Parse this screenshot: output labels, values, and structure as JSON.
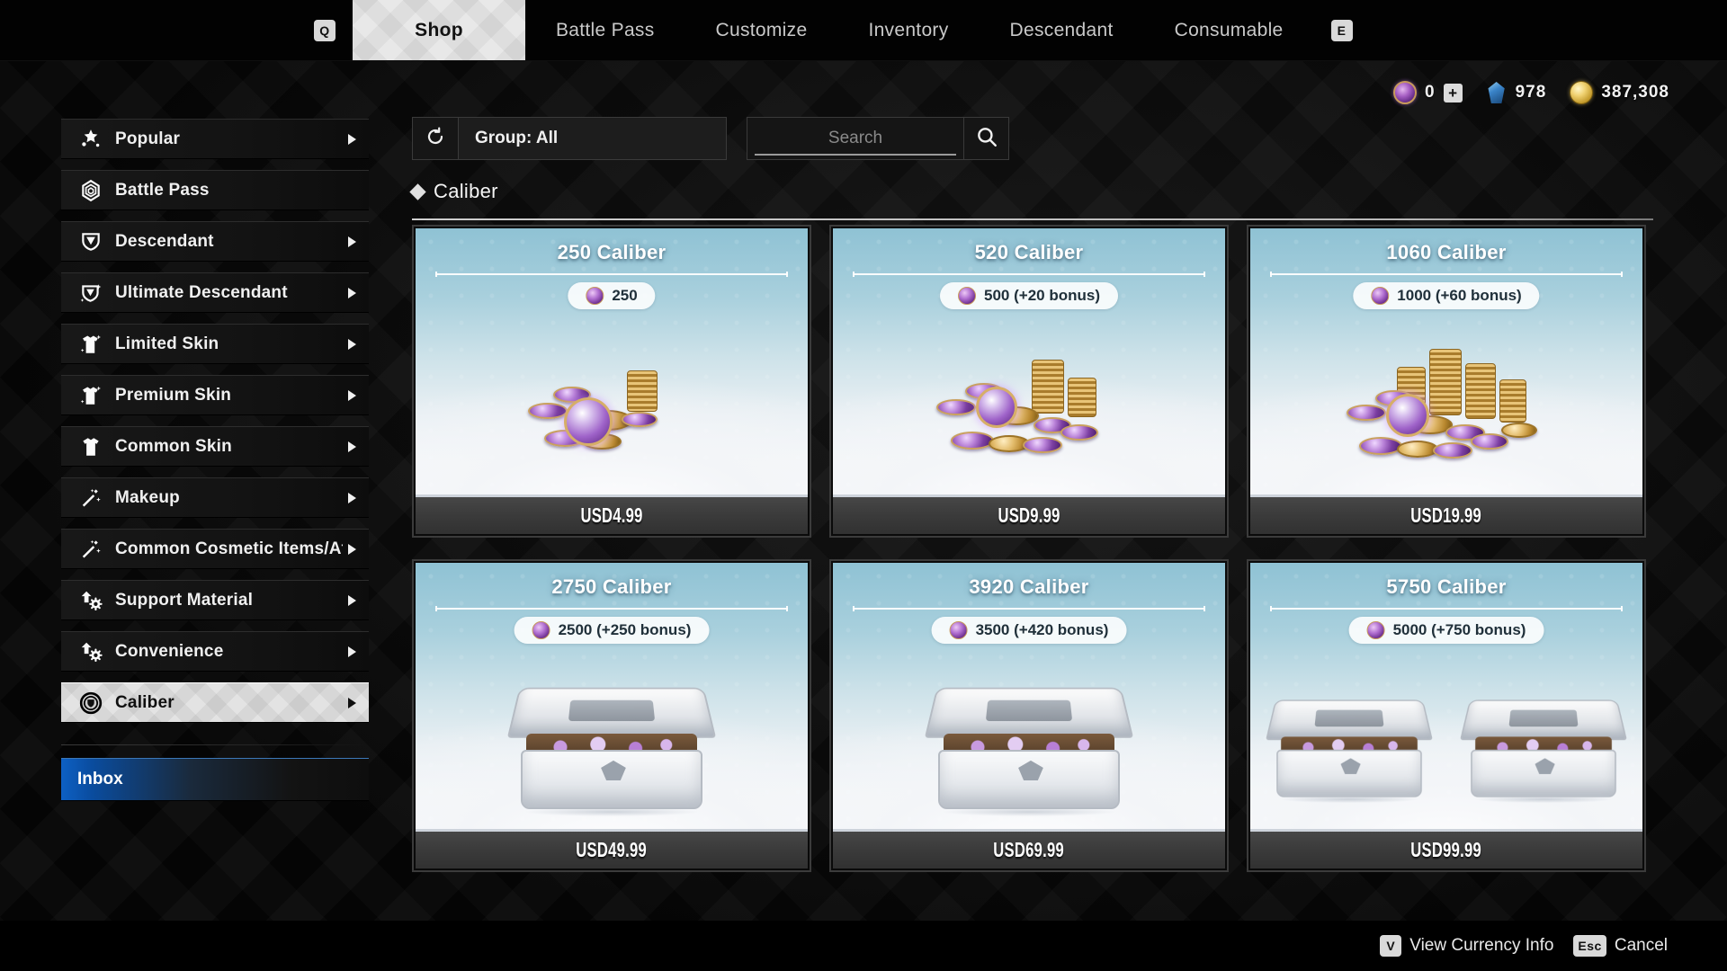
{
  "topnav": {
    "left_key": "Q",
    "right_key": "E",
    "tabs": [
      {
        "label": "Shop",
        "active": true
      },
      {
        "label": "Battle Pass",
        "active": false
      },
      {
        "label": "Customize",
        "active": false
      },
      {
        "label": "Inventory",
        "active": false
      },
      {
        "label": "Descendant",
        "active": false
      },
      {
        "label": "Consumable",
        "active": false
      }
    ]
  },
  "currency": [
    {
      "icon": "caliber-icon",
      "value": "0",
      "has_plus": true,
      "plus_label": "+"
    },
    {
      "icon": "crystal-icon",
      "value": "978",
      "has_plus": false
    },
    {
      "icon": "gold-icon",
      "value": "387,308",
      "has_plus": false
    }
  ],
  "sidebar": {
    "items": [
      {
        "label": "Popular",
        "icon": "stars-icon",
        "chevron": true,
        "selected": false
      },
      {
        "label": "Battle Pass",
        "icon": "hex-spiral-icon",
        "chevron": false,
        "selected": false
      },
      {
        "label": "Descendant",
        "icon": "chevron-crest-icon",
        "chevron": true,
        "selected": false
      },
      {
        "label": "Ultimate Descendant",
        "icon": "chevron-crest-sparkle-icon",
        "chevron": true,
        "selected": false
      },
      {
        "label": "Limited Skin",
        "icon": "shirt-sparkle-icon",
        "chevron": true,
        "selected": false
      },
      {
        "label": "Premium Skin",
        "icon": "shirt-sparkle-icon",
        "chevron": true,
        "selected": false
      },
      {
        "label": "Common Skin",
        "icon": "shirt-icon",
        "chevron": true,
        "selected": false
      },
      {
        "label": "Makeup",
        "icon": "magic-wand-icon",
        "chevron": true,
        "selected": false
      },
      {
        "label": "Common Cosmetic Items/Atta",
        "icon": "magic-wand-icon",
        "chevron": true,
        "selected": false
      },
      {
        "label": "Support Material",
        "icon": "upgrade-gear-icon",
        "chevron": true,
        "selected": false
      },
      {
        "label": "Convenience",
        "icon": "upgrade-gear-icon",
        "chevron": true,
        "selected": false
      },
      {
        "label": "Caliber",
        "icon": "caliber-crest-icon",
        "chevron": true,
        "selected": true
      }
    ],
    "inbox": {
      "label": "Inbox",
      "icon": "inbox-icon"
    }
  },
  "toolbar": {
    "refresh_icon": "refresh-icon",
    "group_label": "Group: All",
    "search_value": "",
    "search_placeholder": "Search",
    "search_icon": "search-icon"
  },
  "section": {
    "bullet_icon": "diamond-bullet-icon",
    "title": "Caliber"
  },
  "cards": [
    {
      "title": "250 Caliber",
      "amount": "250",
      "price": "USD4.99",
      "art": "coins-small"
    },
    {
      "title": "520 Caliber",
      "amount": "500 (+20 bonus)",
      "price": "USD9.99",
      "art": "coins-medium"
    },
    {
      "title": "1060 Caliber",
      "amount": "1000 (+60 bonus)",
      "price": "USD19.99",
      "art": "coins-large"
    },
    {
      "title": "2750 Caliber",
      "amount": "2500 (+250 bonus)",
      "price": "USD49.99",
      "art": "chest-one"
    },
    {
      "title": "3920 Caliber",
      "amount": "3500 (+420 bonus)",
      "price": "USD69.99",
      "art": "chest-one"
    },
    {
      "title": "5750 Caliber",
      "amount": "5000 (+750 bonus)",
      "price": "USD99.99",
      "art": "chest-two"
    }
  ],
  "footer": [
    {
      "key": "V",
      "label": "View Currency Info"
    },
    {
      "key": "Esc",
      "label": "Cancel"
    }
  ],
  "colors": {
    "accent_light": "#e8e8e8",
    "card_teal": "#8fc2d4",
    "price_bar": "#3b3b3b",
    "inbox_blue": "#0d60c4"
  }
}
